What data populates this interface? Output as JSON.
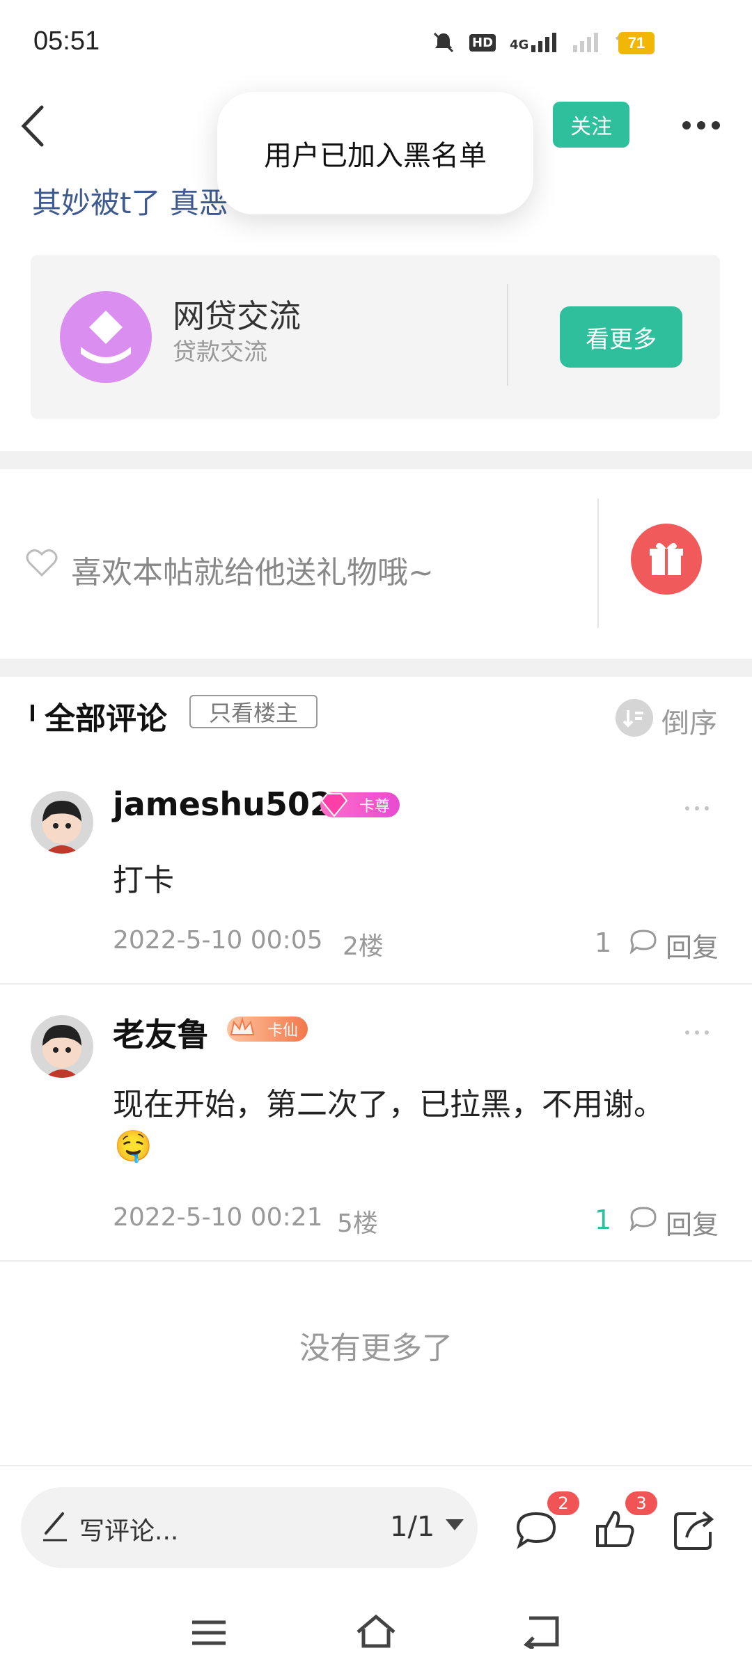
{
  "status_bar": {
    "time": "05:51",
    "battery": "71",
    "network": "4G",
    "hd_label": "HD"
  },
  "header": {
    "follow_label": "关注",
    "post_title_fragment": "其妙被t了 真恶"
  },
  "toast": {
    "message": "用户已加入黑名单"
  },
  "forum": {
    "name": "网贷交流",
    "subtitle": "贷款交流",
    "see_more_label": "看更多",
    "icon_color": "#d98ef0"
  },
  "gift": {
    "prompt": "喜欢本帖就给他送礼物哦~"
  },
  "comments_header": {
    "title": "全部评论",
    "op_only_label": "只看楼主",
    "sort_label": "倒序"
  },
  "comments": [
    {
      "username": "jameshu502",
      "badge": "卡尊",
      "text": "打卡",
      "date": "2022-5-10 00:05",
      "floor": "2楼",
      "likes": "1",
      "reply_label": "回复"
    },
    {
      "username": "老友鲁",
      "badge": "卡仙",
      "text": "现在开始，第二次了，已拉黑，不用谢。",
      "emoji": "🤤",
      "date": "2022-5-10 00:21",
      "floor": "5楼",
      "likes": "1",
      "reply_label": "回复"
    }
  ],
  "no_more_text": "没有更多了",
  "bottom_bar": {
    "comment_placeholder": "写评论...",
    "page_indicator": "1/1",
    "comment_count": "2",
    "like_count": "3"
  },
  "colors": {
    "accent": "#2fbf9d",
    "badge_red": "#f05454",
    "title_blue": "#3e5a8e"
  }
}
